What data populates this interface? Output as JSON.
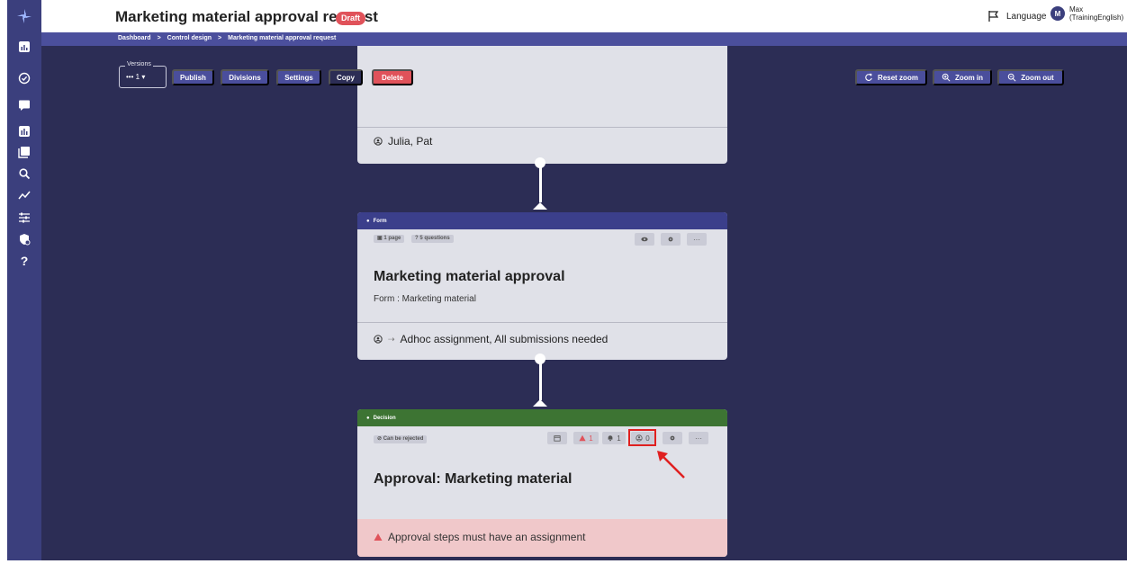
{
  "header": {
    "title": "Marketing material approval request",
    "status_badge": "Draft",
    "language_label": "Language",
    "user_initial": "M",
    "user_name_line1": "Max",
    "user_name_line2": "(TrainingEnglish)"
  },
  "breadcrumb": [
    "Dashboard",
    "Control design",
    "Marketing material approval request"
  ],
  "breadcrumb_separator": ">",
  "toolbar": {
    "versions_label": "Versions",
    "versions_value": "1",
    "publish": "Publish",
    "divisions": "Divisions",
    "settings": "Settings",
    "copy": "Copy",
    "delete": "Delete",
    "reset_zoom": "Reset zoom",
    "zoom_in": "Zoom in",
    "zoom_out": "Zoom out"
  },
  "top_card": {
    "assignees": "Julia, Pat"
  },
  "form_card": {
    "type": "Form",
    "pages": "1 page",
    "questions": "5 questions",
    "title": "Marketing material approval",
    "subtitle": "Form : Marketing material",
    "assignment": "Adhoc assignment, All submissions needed"
  },
  "decision_card": {
    "type": "Decision",
    "rejectable": "Can be rejected",
    "warning_count": "1",
    "notification_count": "1",
    "assignee_count": "0",
    "title": "Approval: Marketing material",
    "warning_message": "Approval steps must have an assignment"
  },
  "colors": {
    "sidebar": "#3b3f7d",
    "canvas": "#2c2d55",
    "primary_button": "#4a4e9c",
    "danger": "#e0525a",
    "decision_header": "#3d7433",
    "form_header": "#3b3f8b",
    "annotation": "#e02020"
  },
  "sidebar_icons": [
    "logo-icon",
    "dashboard-icon",
    "check-icon",
    "chat-icon",
    "reports-icon",
    "library-icon",
    "search-icon",
    "trend-icon",
    "filters-icon",
    "shield-icon",
    "help-icon"
  ]
}
